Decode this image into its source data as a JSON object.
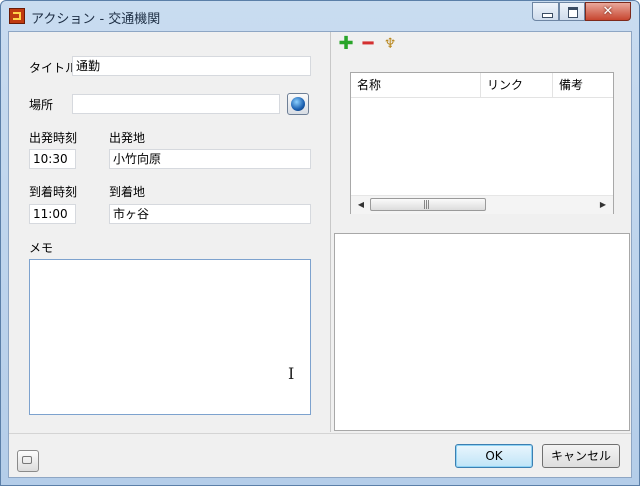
{
  "window": {
    "title": "アクション - 交通機関",
    "close_glyph": "✕"
  },
  "form": {
    "title_label": "タイトル",
    "title_value": "通勤",
    "place_label": "場所",
    "place_value": "",
    "depart_time_label": "出発時刻",
    "depart_time_value": "10:30",
    "depart_place_label": "出発地",
    "depart_place_value": "小竹向原",
    "arrive_time_label": "到着時刻",
    "arrive_time_value": "11:00",
    "arrive_place_label": "到着地",
    "arrive_place_value": "市ヶ谷",
    "memo_label": "メモ",
    "memo_value": ""
  },
  "toolbar": {
    "add_glyph": "✚",
    "remove_glyph": "━",
    "tool_glyph": "♆"
  },
  "list": {
    "columns": [
      "名称",
      "リンク",
      "備考"
    ],
    "rows": [],
    "scroll_left_glyph": "◀",
    "scroll_right_glyph": "▶",
    "grip_glyph": "|||"
  },
  "buttons": {
    "ok": "OK",
    "cancel": "キャンセル"
  },
  "icons": {
    "app": "app-icon",
    "globe": "globe-icon",
    "add": "plus-icon",
    "remove": "minus-icon",
    "tool": "wrench-icon",
    "help": "help-icon"
  }
}
